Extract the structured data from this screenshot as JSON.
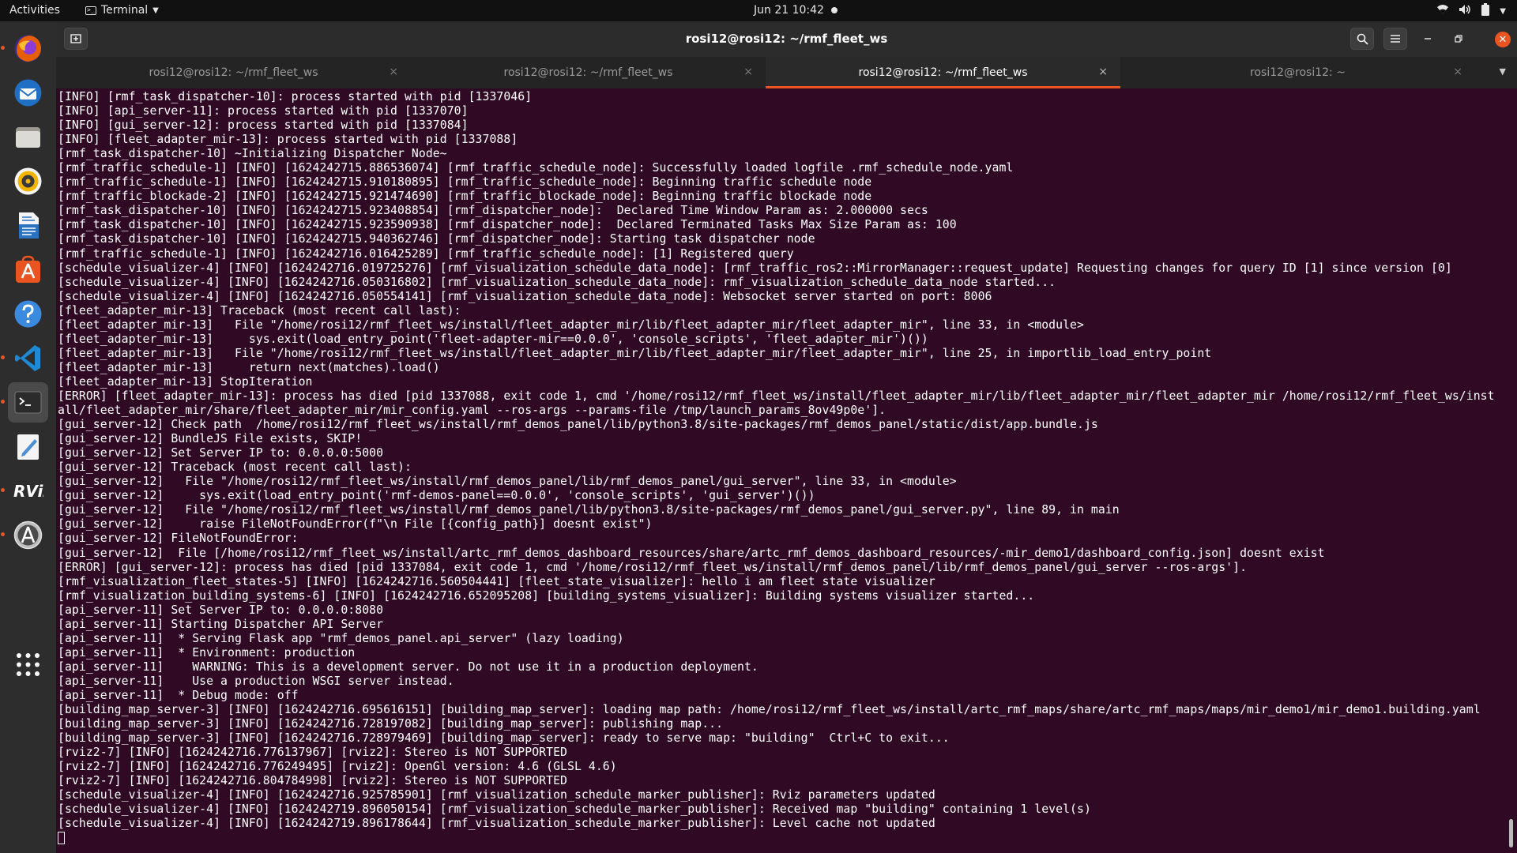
{
  "topbar": {
    "activities": "Activities",
    "app_name": "Terminal",
    "clock": "Jun 21  10:42"
  },
  "dock": {
    "items": [
      {
        "name": "firefox-icon",
        "color": "#e66000",
        "running": true
      },
      {
        "name": "thunderbird-icon",
        "color": "#1f6fc5",
        "running": false
      },
      {
        "name": "files-icon",
        "color": "#9a9890",
        "running": false
      },
      {
        "name": "rhythmbox-icon",
        "color": "#f3b500",
        "running": false
      },
      {
        "name": "libreoffice-writer-icon",
        "color": "#2a73c0",
        "running": false
      },
      {
        "name": "software-center-icon",
        "color": "#e95420",
        "running": false
      },
      {
        "name": "help-icon",
        "color": "#3a8be0",
        "running": false
      },
      {
        "name": "vscode-icon",
        "color": "#1e8ad6",
        "running": true
      },
      {
        "name": "terminal-icon",
        "color": "#2b2b2b",
        "running": true
      },
      {
        "name": "text-editor-icon",
        "color": "#4c8fd6",
        "running": false
      },
      {
        "name": "rviz-icon",
        "color": "#ffffff",
        "running": true
      },
      {
        "name": "software-updater-icon",
        "color": "#c8c8c8",
        "running": true
      },
      {
        "name": "show-applications-icon",
        "color": "#ffffff",
        "running": false
      }
    ]
  },
  "window": {
    "title": "rosi12@rosi12: ~/rmf_fleet_ws",
    "tabs": [
      {
        "label": "rosi12@rosi12: ~/rmf_fleet_ws",
        "active": false
      },
      {
        "label": "rosi12@rosi12: ~/rmf_fleet_ws",
        "active": false
      },
      {
        "label": "rosi12@rosi12: ~/rmf_fleet_ws",
        "active": true
      },
      {
        "label": "rosi12@rosi12: ~",
        "active": false
      }
    ],
    "tab_close_glyph": "×"
  },
  "terminal": {
    "lines": [
      "[INFO] [rmf_task_dispatcher-10]: process started with pid [1337046]",
      "[INFO] [api_server-11]: process started with pid [1337070]",
      "[INFO] [gui_server-12]: process started with pid [1337084]",
      "[INFO] [fleet_adapter_mir-13]: process started with pid [1337088]",
      "[rmf_task_dispatcher-10] ~Initializing Dispatcher Node~",
      "[rmf_traffic_schedule-1] [INFO] [1624242715.886536074] [rmf_traffic_schedule_node]: Successfully loaded logfile .rmf_schedule_node.yaml",
      "[rmf_traffic_schedule-1] [INFO] [1624242715.910180895] [rmf_traffic_schedule_node]: Beginning traffic schedule node",
      "[rmf_traffic_blockade-2] [INFO] [1624242715.921474690] [rmf_traffic_blockade_node]: Beginning traffic blockade node",
      "[rmf_task_dispatcher-10] [INFO] [1624242715.923408854] [rmf_dispatcher_node]:  Declared Time Window Param as: 2.000000 secs",
      "[rmf_task_dispatcher-10] [INFO] [1624242715.923590938] [rmf_dispatcher_node]:  Declared Terminated Tasks Max Size Param as: 100",
      "[rmf_task_dispatcher-10] [INFO] [1624242715.940362746] [rmf_dispatcher_node]: Starting task dispatcher node",
      "[rmf_traffic_schedule-1] [INFO] [1624242716.016425289] [rmf_traffic_schedule_node]: [1] Registered query",
      "[schedule_visualizer-4] [INFO] [1624242716.019725276] [rmf_visualization_schedule_data_node]: [rmf_traffic_ros2::MirrorManager::request_update] Requesting changes for query ID [1] since version [0]",
      "[schedule_visualizer-4] [INFO] [1624242716.050316802] [rmf_visualization_schedule_data_node]: rmf_visualization_schedule_data_node started...",
      "[schedule_visualizer-4] [INFO] [1624242716.050554141] [rmf_visualization_schedule_data_node]: Websocket server started on port: 8006",
      "[fleet_adapter_mir-13] Traceback (most recent call last):",
      "[fleet_adapter_mir-13]   File \"/home/rosi12/rmf_fleet_ws/install/fleet_adapter_mir/lib/fleet_adapter_mir/fleet_adapter_mir\", line 33, in <module>",
      "[fleet_adapter_mir-13]     sys.exit(load_entry_point('fleet-adapter-mir==0.0.0', 'console_scripts', 'fleet_adapter_mir')())",
      "[fleet_adapter_mir-13]   File \"/home/rosi12/rmf_fleet_ws/install/fleet_adapter_mir/lib/fleet_adapter_mir/fleet_adapter_mir\", line 25, in importlib_load_entry_point",
      "[fleet_adapter_mir-13]     return next(matches).load()",
      "[fleet_adapter_mir-13] StopIteration",
      "[ERROR] [fleet_adapter_mir-13]: process has died [pid 1337088, exit code 1, cmd '/home/rosi12/rmf_fleet_ws/install/fleet_adapter_mir/lib/fleet_adapter_mir/fleet_adapter_mir /home/rosi12/rmf_fleet_ws/inst",
      "all/fleet_adapter_mir/share/fleet_adapter_mir/mir_config.yaml --ros-args --params-file /tmp/launch_params_8ov49p0e'].",
      "[gui_server-12] Check path  /home/rosi12/rmf_fleet_ws/install/rmf_demos_panel/lib/python3.8/site-packages/rmf_demos_panel/static/dist/app.bundle.js",
      "[gui_server-12] BundleJS File exists, SKIP!",
      "[gui_server-12] Set Server IP to: 0.0.0.0:5000",
      "[gui_server-12] Traceback (most recent call last):",
      "[gui_server-12]   File \"/home/rosi12/rmf_fleet_ws/install/rmf_demos_panel/lib/rmf_demos_panel/gui_server\", line 33, in <module>",
      "[gui_server-12]     sys.exit(load_entry_point('rmf-demos-panel==0.0.0', 'console_scripts', 'gui_server')())",
      "[gui_server-12]   File \"/home/rosi12/rmf_fleet_ws/install/rmf_demos_panel/lib/python3.8/site-packages/rmf_demos_panel/gui_server.py\", line 89, in main",
      "[gui_server-12]     raise FileNotFoundError(f\"\\n File [{config_path}] doesnt exist\")",
      "[gui_server-12] FileNotFoundError:",
      "[gui_server-12]  File [/home/rosi12/rmf_fleet_ws/install/artc_rmf_demos_dashboard_resources/share/artc_rmf_demos_dashboard_resources/-mir_demo1/dashboard_config.json] doesnt exist",
      "[ERROR] [gui_server-12]: process has died [pid 1337084, exit code 1, cmd '/home/rosi12/rmf_fleet_ws/install/rmf_demos_panel/lib/rmf_demos_panel/gui_server --ros-args'].",
      "[rmf_visualization_fleet_states-5] [INFO] [1624242716.560504441] [fleet_state_visualizer]: hello i am fleet state visualizer",
      "[rmf_visualization_building_systems-6] [INFO] [1624242716.652095208] [building_systems_visualizer]: Building systems visualizer started...",
      "[api_server-11] Set Server IP to: 0.0.0.0:8080",
      "[api_server-11] Starting Dispatcher API Server",
      "[api_server-11]  * Serving Flask app \"rmf_demos_panel.api_server\" (lazy loading)",
      "[api_server-11]  * Environment: production",
      "[api_server-11]    WARNING: This is a development server. Do not use it in a production deployment.",
      "[api_server-11]    Use a production WSGI server instead.",
      "[api_server-11]  * Debug mode: off",
      "[building_map_server-3] [INFO] [1624242716.695616151] [building_map_server]: loading map path: /home/rosi12/rmf_fleet_ws/install/artc_rmf_maps/share/artc_rmf_maps/maps/mir_demo1/mir_demo1.building.yaml",
      "[building_map_server-3] [INFO] [1624242716.728197082] [building_map_server]: publishing map...",
      "[building_map_server-3] [INFO] [1624242716.728979469] [building_map_server]: ready to serve map: \"building\"  Ctrl+C to exit...",
      "[rviz2-7] [INFO] [1624242716.776137967] [rviz2]: Stereo is NOT SUPPORTED",
      "[rviz2-7] [INFO] [1624242716.776249495] [rviz2]: OpenGl version: 4.6 (GLSL 4.6)",
      "[rviz2-7] [INFO] [1624242716.804784998] [rviz2]: Stereo is NOT SUPPORTED",
      "[schedule_visualizer-4] [INFO] [1624242716.925785901] [rmf_visualization_schedule_marker_publisher]: Rviz parameters updated",
      "[schedule_visualizer-4] [INFO] [1624242719.896050154] [rmf_visualization_schedule_marker_publisher]: Received map \"building\" containing 1 level(s)",
      "[schedule_visualizer-4] [INFO] [1624242719.896178644] [rmf_visualization_schedule_marker_publisher]: Level cache not updated"
    ]
  },
  "colors": {
    "terminal_bg": "#300a24",
    "accent": "#e95420",
    "text": "#ffffff"
  }
}
